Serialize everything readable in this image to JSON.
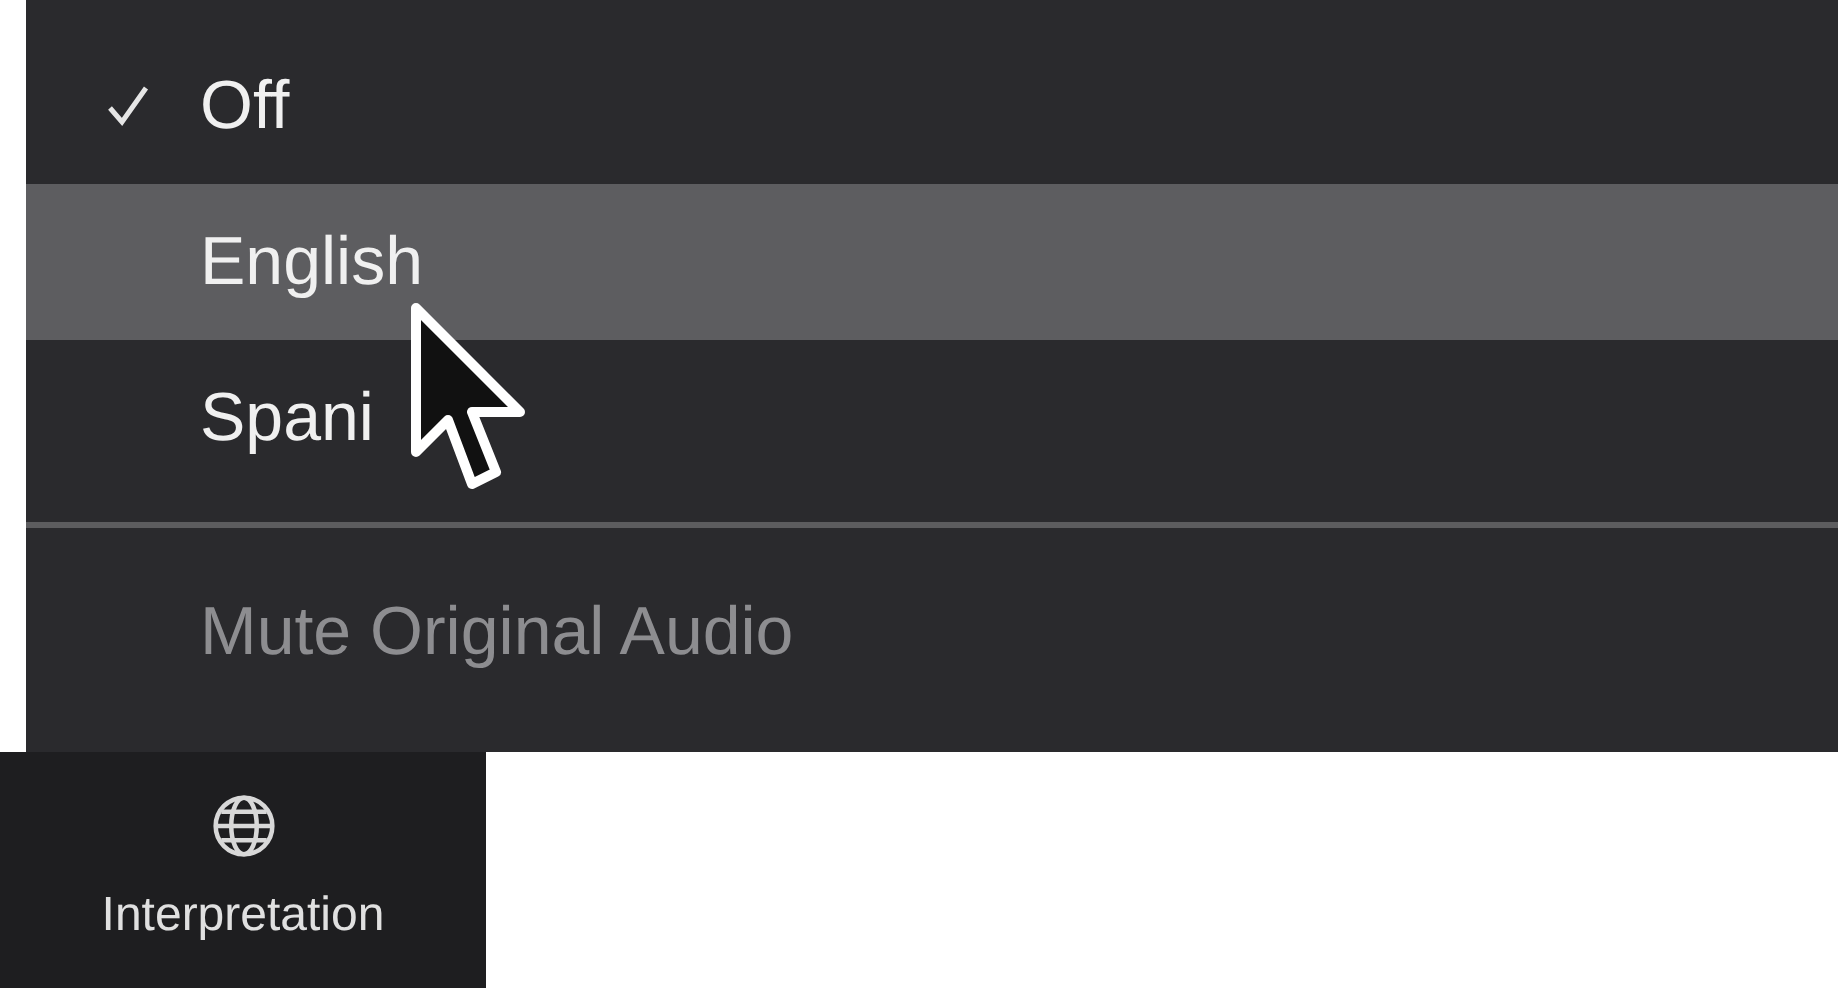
{
  "menu": {
    "items": [
      {
        "kind": "option",
        "label": "Off",
        "checked": true,
        "selected": false
      },
      {
        "kind": "option",
        "label": "English",
        "checked": false,
        "selected": true
      },
      {
        "kind": "option",
        "label": "Spani",
        "checked": false,
        "selected": false
      },
      {
        "kind": "separator"
      },
      {
        "kind": "action",
        "label": "Mute Original Audio",
        "disabled": true
      }
    ]
  },
  "toolbar_button": {
    "label": "Interpretation"
  }
}
